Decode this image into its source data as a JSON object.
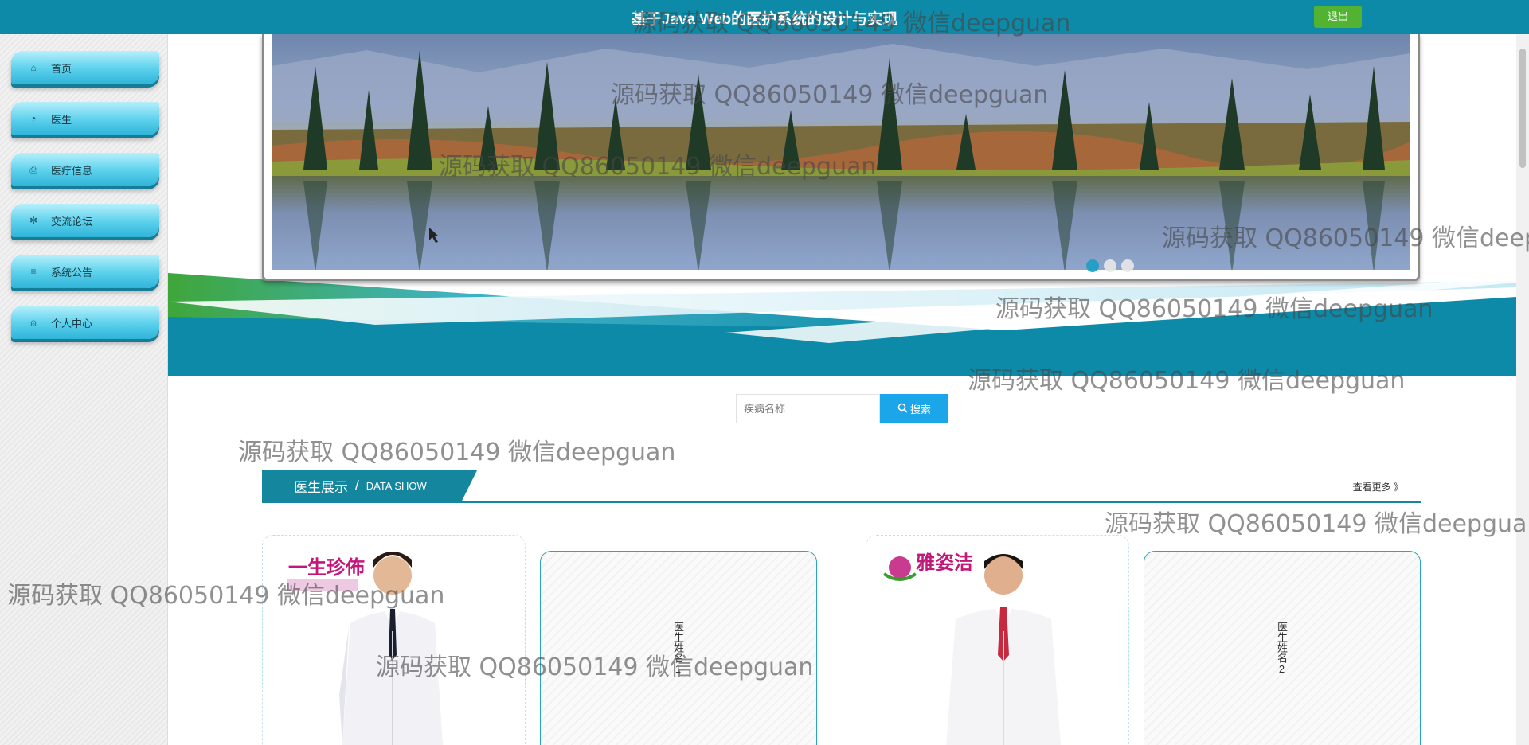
{
  "header": {
    "title": "基于Java Web的医护系统的设计与实现",
    "logout_label": "退出"
  },
  "sidebar": {
    "items": [
      {
        "label": "首页",
        "icon": "home-icon",
        "glyph": "⌂"
      },
      {
        "label": "医生",
        "icon": "gauge-icon",
        "glyph": "◔"
      },
      {
        "label": "医疗信息",
        "icon": "printer-icon",
        "glyph": "⎙"
      },
      {
        "label": "交流论坛",
        "icon": "snowflake-icon",
        "glyph": "✻"
      },
      {
        "label": "系统公告",
        "icon": "sliders-icon",
        "glyph": "≡"
      },
      {
        "label": "个人中心",
        "icon": "user-icon",
        "glyph": "⍝"
      }
    ]
  },
  "carousel": {
    "slide_count": 3,
    "active_index": 0
  },
  "search": {
    "placeholder": "疾病名称",
    "button_label": "搜索"
  },
  "section": {
    "title_zh": "医生展示",
    "separator": "/",
    "title_en": "DATA SHOW",
    "more_label": "查看更多 》"
  },
  "doctors": [
    {
      "name": "医生姓名1",
      "brand_logo": "一生珍佈"
    },
    {
      "name": "医生姓名2",
      "brand_logo": "雅姿洁"
    }
  ],
  "watermark": "源码获取 QQ86050149 微信deepguan",
  "colors": {
    "header_bg": "#0e8aa9",
    "logout_bg": "#52b332",
    "search_btn_bg": "#1aa6e8",
    "section_accent": "#14879f",
    "nav_gradient": "#5ad0ec"
  }
}
